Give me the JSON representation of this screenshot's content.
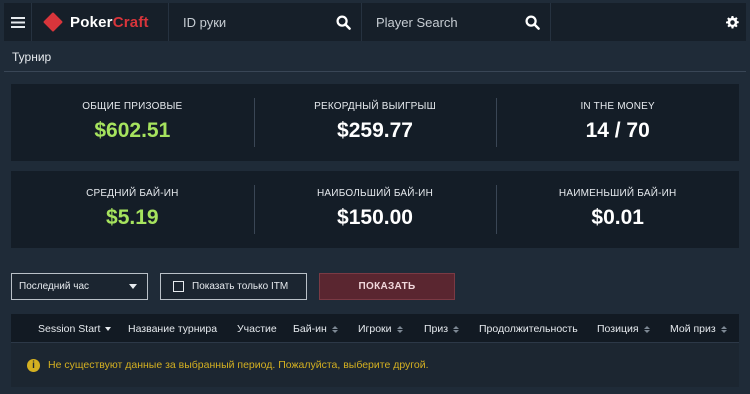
{
  "header": {
    "logo_prefix": "Poker",
    "logo_suffix": "Craft",
    "hand_search_placeholder": "ID руки",
    "player_search_placeholder": "Player Search"
  },
  "section": {
    "title": "Турнир"
  },
  "stats": {
    "row1": [
      {
        "label": "ОБЩИЕ ПРИЗОВЫЕ",
        "value": "$602.51",
        "color": "green"
      },
      {
        "label": "РЕКОРДНЫЙ ВЫИГРЫШ",
        "value": "$259.77",
        "color": "white"
      },
      {
        "label": "IN THE MONEY",
        "value": "14 / 70",
        "color": "white"
      }
    ],
    "row2": [
      {
        "label": "СРЕДНИЙ БАЙ-ИН",
        "value": "$5.19",
        "color": "green"
      },
      {
        "label": "НАИБОЛЬШИЙ БАЙ-ИН",
        "value": "$150.00",
        "color": "white"
      },
      {
        "label": "НАИМЕНЬШИЙ БАЙ-ИН",
        "value": "$0.01",
        "color": "white"
      }
    ]
  },
  "filters": {
    "period_selected": "Последний час",
    "itm_only_label": "Показать только ITM",
    "show_button": "ПОКАЗАТЬ"
  },
  "table": {
    "columns": [
      "Session Start",
      "Название турнира",
      "Участие",
      "Бай-ин",
      "Игроки",
      "Приз",
      "Продолжительность",
      "Позиция",
      "Мой приз"
    ]
  },
  "notice": {
    "icon": "info-icon",
    "message": "Не существуют данные за выбранный период. Пожалуйста, выберите другой."
  },
  "colors": {
    "accent_red": "#d8353b",
    "green_value": "#a6e35e",
    "warning_yellow": "#d4b021"
  }
}
